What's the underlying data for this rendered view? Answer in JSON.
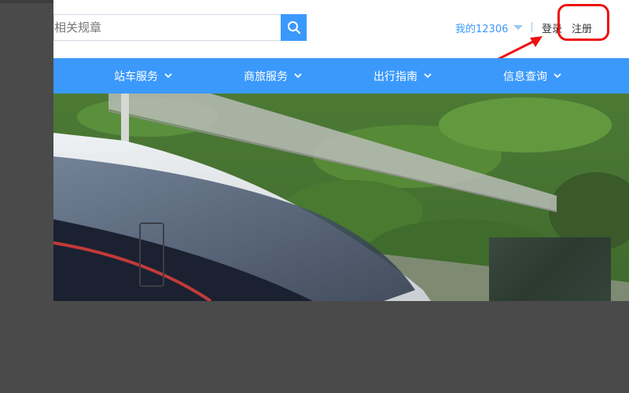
{
  "header": {
    "search_placeholder": "相关规章",
    "account_label": "我的12306",
    "login_label": "登录",
    "register_label": "注册"
  },
  "nav": {
    "items": [
      {
        "label": "站车服务"
      },
      {
        "label": "商旅服务"
      },
      {
        "label": "出行指南"
      },
      {
        "label": "信息查询"
      }
    ]
  },
  "colors": {
    "brand_blue": "#3b99fc",
    "annotation_red": "#ee1111"
  }
}
